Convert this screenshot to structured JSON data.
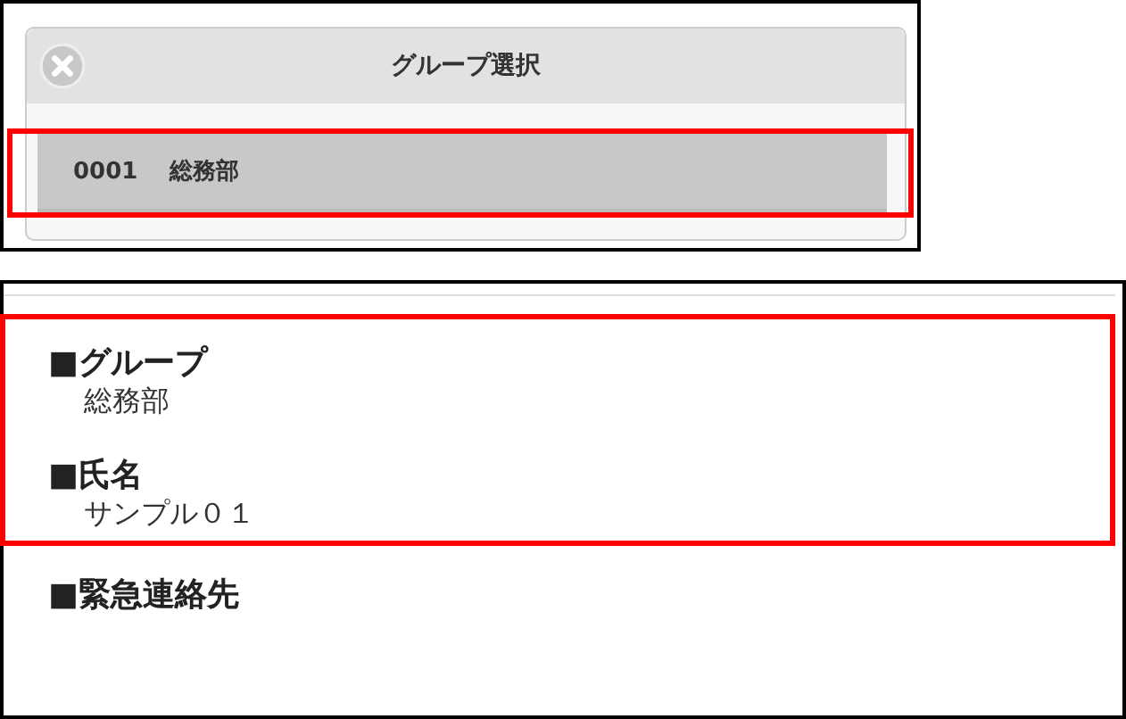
{
  "dialog": {
    "title": "グループ選択",
    "options": [
      {
        "code": "0001",
        "name": "総務部",
        "selected": true,
        "highlighted": true
      }
    ]
  },
  "detail": {
    "sections": [
      {
        "highlighted": true,
        "fields": [
          {
            "label": "■グループ",
            "value": "総務部"
          },
          {
            "label": "■氏名",
            "value": "サンプル０１"
          }
        ]
      },
      {
        "highlighted": false,
        "fields": [
          {
            "label": "■緊急連絡先"
          }
        ]
      }
    ]
  }
}
